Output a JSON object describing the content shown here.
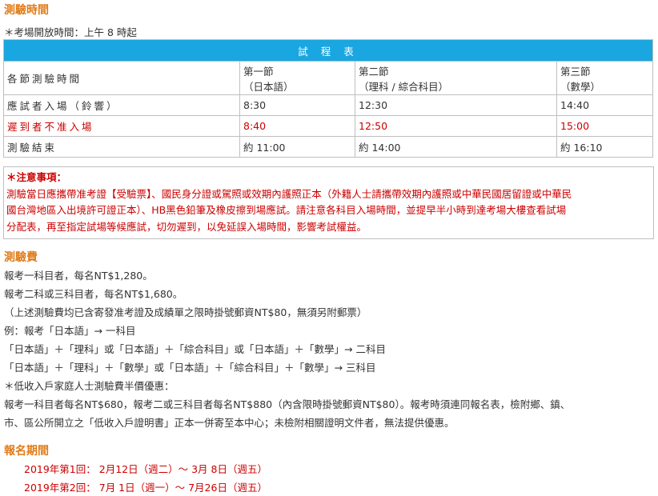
{
  "exam_time": {
    "heading": "測驗時間",
    "open_note": "＊考場開放時間：上午 8 時起",
    "table_title": "試 程 表",
    "header_label": "各節測驗時間",
    "sessions": [
      {
        "line1": "第一節",
        "line2": "（日本語）"
      },
      {
        "line1": "第二節",
        "line2": "（理科 / 綜合科目）"
      },
      {
        "line1": "第三節",
        "line2": "（數學）"
      }
    ],
    "rows": [
      {
        "label": "應試者入場（鈴響）",
        "values": [
          "8:30",
          "12:30",
          "14:40"
        ]
      },
      {
        "label": "遲到者不准入場",
        "values": [
          "8:40",
          "12:50",
          "15:00"
        ]
      },
      {
        "label": "測驗結束",
        "values": [
          "約 11:00",
          "約 14:00",
          "約 16:10"
        ]
      }
    ],
    "notice_title": "＊注意事項：",
    "notice_lines": [
      "測驗當日應攜帶准考證【受驗票】、國民身分證或駕照或效期內護照正本（外籍人士請攜帶效期內護照或中華民國居留證或中華民",
      "國台灣地區入出境許可證正本）、HB黑色鉛筆及橡皮擦到場應試。請注意各科目入場時間，並提早半小時到達考場大樓查看試場",
      "分配表，再至指定試場等候應試，切勿遲到，以免延誤入場時間，影響考試權益。"
    ]
  },
  "exam_fee": {
    "heading": "測驗費",
    "lines": [
      "報考一科目者，每名NT$1,280。",
      "報考二科或三科目者，每名NT$1,680。",
      "（上述測驗費均已含寄發准考證及成績單之限時掛號郵資NT$80，無須另附郵票）",
      "例：報考「日本語」→ 一科目",
      "「日本語」＋「理科」或「日本語」＋「綜合科目」或「日本語」＋「數學」→ 二科目",
      "「日本語」＋「理科」＋「數學」或「日本語」＋「綜合科目」＋「數學」→ 三科目",
      "＊低收入戶家庭人士測驗費半價優惠：",
      "報考一科目者每名NT$680，報考二或三科目者每名NT$880（內含限時掛號郵資NT$80）。報考時須連同報名表，檢附鄉、鎮、",
      "市、區公所開立之「低收入戶證明書」正本一併寄至本中心；未檢附相關證明文件者，無法提供優惠。"
    ]
  },
  "registration": {
    "heading": "報名期間",
    "sessions": [
      "2019年第1回： 2月12日（週二）～ 3月 8日（週五）",
      "2019年第2回： 7月 1日（週一）～ 7月26日（週五）"
    ]
  }
}
